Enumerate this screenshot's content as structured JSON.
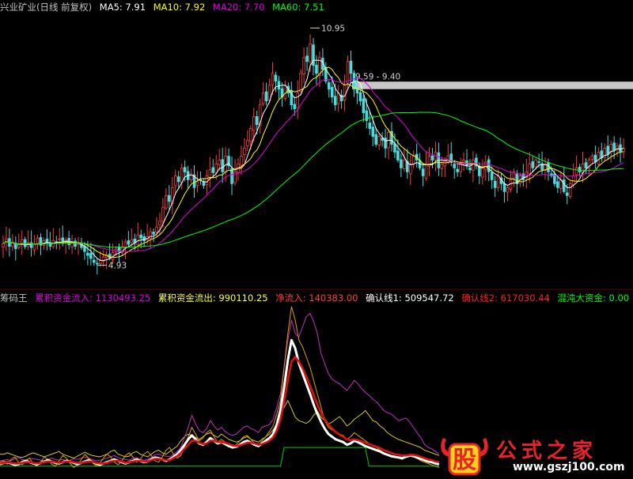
{
  "top_legend": {
    "stock": "兴业矿业(日线 前复权)",
    "items": [
      {
        "text": "MA5: 7.91",
        "color": "#ffffff"
      },
      {
        "text": "MA10: 7.92",
        "color": "#ffff00"
      },
      {
        "text": "MA20: 7.70",
        "color": "#e000e0"
      },
      {
        "text": "MA60: 7.51",
        "color": "#00ff00"
      }
    ]
  },
  "bottom_legend": {
    "title": "筹码王",
    "items": [
      {
        "text": "累积资金流入: 1130493.25",
        "color": "#e000e0"
      },
      {
        "text": "累积资金流出: 990110.25",
        "color": "#ffff40"
      },
      {
        "text": "净流入: 140383.00",
        "color": "#ff4040"
      },
      {
        "text": "确认线1: 509547.72",
        "color": "#ffffff"
      },
      {
        "text": "确认线2: 617030.44",
        "color": "#ff2020"
      },
      {
        "text": "混沌大资金: 0.00",
        "color": "#00ff00"
      }
    ]
  },
  "chart_data": [
    {
      "type": "candlestick",
      "title": "兴业矿业(日线 前复权)",
      "ylim": [
        4.4,
        11.3
      ],
      "annotations": [
        {
          "text": "10.95",
          "value": 10.95,
          "kind": "high"
        },
        {
          "text": "4.93",
          "value": 4.93,
          "kind": "low"
        },
        {
          "text": "9.59 - 9.40",
          "range": [
            9.4,
            9.59
          ],
          "kind": "band"
        }
      ],
      "series": [
        {
          "name": "MA5",
          "color": "#ffffff"
        },
        {
          "name": "MA10",
          "color": "#ffff00"
        },
        {
          "name": "MA20",
          "color": "#e000e0"
        },
        {
          "name": "MA60",
          "color": "#00ff00"
        }
      ],
      "close": [
        5.48,
        5.6,
        5.41,
        5.52,
        5.35,
        5.45,
        5.58,
        5.4,
        5.5,
        5.38,
        5.47,
        5.62,
        5.44,
        5.55,
        5.49,
        5.41,
        5.56,
        5.52,
        5.6,
        5.48,
        5.57,
        5.45,
        5.53,
        5.41,
        5.5,
        5.38,
        5.28,
        5.18,
        5.1,
        5.0,
        4.96,
        5.05,
        5.14,
        5.2,
        5.12,
        5.25,
        5.34,
        5.28,
        5.4,
        5.52,
        5.46,
        5.58,
        5.5,
        5.7,
        5.62,
        5.55,
        5.66,
        5.78,
        5.72,
        5.9,
        6.05,
        6.4,
        6.7,
        6.55,
        6.9,
        7.2,
        7.05,
        7.4,
        7.3,
        7.1,
        7.25,
        6.9,
        7.05,
        7.1,
        6.95,
        7.2,
        7.35,
        7.28,
        7.5,
        7.6,
        7.3,
        7.7,
        7.45,
        7.0,
        7.3,
        7.5,
        7.7,
        7.9,
        8.1,
        8.4,
        8.7,
        8.5,
        9.0,
        9.3,
        9.1,
        9.5,
        9.8,
        9.6,
        9.4,
        9.2,
        9.5,
        9.3,
        9.0,
        8.9,
        9.3,
        9.8,
        10.2,
        10.1,
        10.55,
        10.0,
        9.8,
        10.2,
        9.9,
        9.6,
        9.4,
        9.2,
        9.0,
        9.3,
        9.1,
        9.5,
        10.1,
        9.8,
        9.4,
        9.3,
        9.1,
        8.8,
        8.6,
        8.4,
        8.2,
        8.0,
        8.2,
        8.1,
        7.9,
        8.3,
        8.0,
        7.8,
        7.6,
        7.4,
        7.6,
        7.3,
        7.5,
        7.7,
        7.6,
        7.4,
        7.2,
        7.5,
        7.7,
        7.6,
        7.8,
        7.4,
        7.5,
        7.6,
        7.7,
        7.55,
        7.4,
        7.3,
        7.5,
        7.6,
        7.45,
        7.35,
        7.6,
        7.45,
        7.2,
        7.4,
        7.55,
        7.3,
        7.1,
        6.9,
        7.2,
        7.0,
        6.8,
        6.9,
        7.1,
        7.3,
        7.0,
        7.2,
        7.1,
        7.3,
        7.5,
        7.4,
        7.6,
        7.55,
        7.35,
        7.5,
        7.3,
        7.2,
        7.0,
        6.9,
        7.1,
        6.8,
        6.7,
        7.0,
        7.2,
        7.4,
        7.3,
        7.5,
        7.4,
        7.6,
        7.7,
        7.55,
        7.8,
        7.65,
        7.9,
        7.75,
        8.0,
        7.85,
        7.95,
        7.8,
        7.9
      ]
    },
    {
      "type": "line",
      "title": "筹码王",
      "series": [
        {
          "name": "累积资金流入",
          "color": "#c030c0",
          "values": [
            20,
            21,
            22,
            20,
            23,
            25,
            22,
            21,
            24,
            23,
            22,
            21,
            20,
            22,
            24,
            22,
            21,
            22,
            20,
            21,
            23,
            22,
            24,
            26,
            24,
            22,
            20,
            21,
            22,
            24,
            26,
            28,
            25,
            23,
            22,
            21,
            24,
            25,
            22,
            21,
            22,
            25,
            29,
            30,
            28,
            27,
            26,
            30,
            34,
            40,
            55,
            70,
            88,
            75,
            65,
            62,
            68,
            80,
            72,
            66,
            70,
            64,
            60,
            58,
            60,
            65,
            70,
            72,
            68,
            66,
            62,
            70,
            72,
            74,
            82,
            100,
            120,
            160,
            200,
            230,
            210,
            205,
            220,
            235,
            240,
            228,
            210,
            180,
            165,
            150,
            142,
            138,
            135,
            130,
            125,
            132,
            140,
            135,
            128,
            122,
            118,
            112,
            108,
            102,
            95,
            92,
            90,
            85,
            80,
            82,
            84,
            78,
            70,
            62,
            55,
            45,
            40,
            38,
            34,
            30
          ]
        },
        {
          "name": "累积资金流出",
          "color": "#d8c820",
          "values": [
            30,
            30,
            32,
            30,
            28,
            26,
            25,
            27,
            30,
            32,
            30,
            28,
            26,
            28,
            30,
            32,
            34,
            30,
            28,
            26,
            24,
            27,
            30,
            33,
            30,
            28,
            27,
            26,
            28,
            30,
            34,
            36,
            30,
            28,
            26,
            27,
            32,
            34,
            30,
            28,
            26,
            30,
            34,
            36,
            32,
            30,
            34,
            38,
            42,
            50,
            56,
            60,
            58,
            55,
            52,
            56,
            60,
            62,
            58,
            55,
            60,
            56,
            52,
            50,
            48,
            50,
            54,
            56,
            52,
            50,
            48,
            52,
            56,
            60,
            66,
            75,
            90,
            100,
            110,
            98,
            85,
            80,
            78,
            76,
            80,
            88,
            94,
            85,
            80,
            75,
            78,
            82,
            86,
            80,
            72,
            76,
            82,
            86,
            90,
            95,
            88,
            80,
            78,
            72,
            68,
            62,
            58,
            55,
            52,
            50,
            48,
            46,
            44,
            42,
            40,
            36,
            34,
            32,
            30,
            28
          ]
        },
        {
          "name": "净流入",
          "color": "#d8a000",
          "values": [
            18,
            20,
            15,
            22,
            26,
            18,
            14,
            20,
            24,
            16,
            12,
            18,
            26,
            22,
            15,
            12,
            20,
            28,
            24,
            16,
            10,
            14,
            22,
            30,
            24,
            18,
            12,
            16,
            24,
            30,
            26,
            18,
            14,
            20,
            28,
            32,
            26,
            18,
            22,
            30,
            34,
            28,
            20,
            18,
            26,
            36,
            40,
            30,
            24,
            28,
            40,
            56,
            70,
            60,
            50,
            54,
            62,
            66,
            56,
            48,
            52,
            48,
            42,
            40,
            44,
            50,
            56,
            58,
            52,
            46,
            42,
            50,
            56,
            64,
            72,
            90,
            110,
            160,
            210,
            250,
            230,
            200,
            190,
            175,
            160,
            140,
            120,
            100,
            80,
            70,
            66,
            62,
            60,
            58,
            52,
            56,
            62,
            58,
            54,
            50,
            46,
            42,
            40,
            36,
            32,
            30,
            28,
            26,
            24,
            22,
            26,
            30,
            28,
            24,
            20,
            18,
            16,
            14,
            12,
            10
          ]
        },
        {
          "name": "确认线1",
          "color": "#ffffff",
          "values": [
            15,
            17,
            18,
            16,
            14,
            15,
            18,
            20,
            18,
            16,
            15,
            17,
            19,
            21,
            19,
            17,
            16,
            18,
            20,
            19,
            17,
            15,
            17,
            19,
            21,
            19,
            16,
            14,
            16,
            18,
            20,
            22,
            20,
            18,
            16,
            18,
            20,
            22,
            20,
            18,
            19,
            22,
            25,
            24,
            22,
            20,
            22,
            26,
            30,
            36,
            44,
            52,
            58,
            52,
            46,
            44,
            48,
            54,
            50,
            46,
            48,
            45,
            42,
            40,
            41,
            44,
            48,
            50,
            47,
            44,
            42,
            46,
            50,
            54,
            60,
            74,
            96,
            130,
            170,
            200,
            188,
            165,
            150,
            135,
            120,
            104,
            90,
            78,
            68,
            60,
            56,
            52,
            50,
            48,
            44,
            46,
            50,
            48,
            45,
            42,
            40,
            38,
            36,
            34,
            31,
            29,
            27,
            26,
            25,
            24,
            26,
            28,
            27,
            25,
            23,
            21,
            19,
            18,
            16,
            15
          ]
        },
        {
          "name": "确认线2",
          "color": "#e01010",
          "values": [
            16,
            17,
            18,
            17,
            16,
            16,
            17,
            18,
            18,
            17,
            16,
            17,
            18,
            19,
            19,
            18,
            17,
            18,
            19,
            19,
            18,
            17,
            17,
            18,
            19,
            19,
            17,
            16,
            16,
            17,
            19,
            20,
            20,
            19,
            17,
            18,
            19,
            20,
            20,
            19,
            19,
            21,
            23,
            23,
            22,
            21,
            21,
            24,
            27,
            32,
            38,
            44,
            50,
            50,
            47,
            45,
            46,
            50,
            50,
            48,
            48,
            47,
            45,
            43,
            42,
            43,
            45,
            47,
            47,
            46,
            44,
            45,
            47,
            50,
            55,
            65,
            82,
            108,
            140,
            168,
            175,
            168,
            158,
            146,
            132,
            118,
            104,
            92,
            82,
            74,
            68,
            63,
            59,
            56,
            52,
            51,
            52,
            51,
            49,
            47,
            45,
            43,
            41,
            39,
            36,
            34,
            32,
            30,
            29,
            28,
            28,
            29,
            29,
            28,
            26,
            24,
            22,
            21,
            19,
            18
          ]
        },
        {
          "name": "混沌大资金",
          "color": "#00d000",
          "values": [
            12,
            12,
            12,
            12,
            12,
            12,
            12,
            12,
            12,
            12,
            12,
            12,
            12,
            12,
            12,
            12,
            12,
            12,
            12,
            12,
            12,
            12,
            12,
            12,
            12,
            12,
            12,
            12,
            12,
            12,
            12,
            12,
            12,
            12,
            12,
            12,
            12,
            12,
            12,
            12,
            12,
            12,
            12,
            12,
            12,
            12,
            12,
            12,
            12,
            12,
            12,
            12,
            12,
            12,
            12,
            12,
            12,
            12,
            12,
            12,
            12,
            12,
            12,
            12,
            12,
            12,
            12,
            12,
            12,
            12,
            12,
            12,
            12,
            12,
            12,
            12,
            12,
            40,
            40,
            40,
            40,
            40,
            40,
            40,
            40,
            40,
            40,
            40,
            40,
            40,
            40,
            40,
            40,
            40,
            40,
            40,
            40,
            40,
            40,
            40,
            12,
            12,
            12,
            12,
            12,
            12,
            12,
            12,
            12,
            12,
            12,
            12,
            12,
            12,
            12,
            12,
            12,
            12,
            12,
            12
          ]
        }
      ]
    }
  ],
  "watermark": {
    "badge": "股",
    "brand": "公式之家",
    "url": "www.gszj100.com"
  }
}
